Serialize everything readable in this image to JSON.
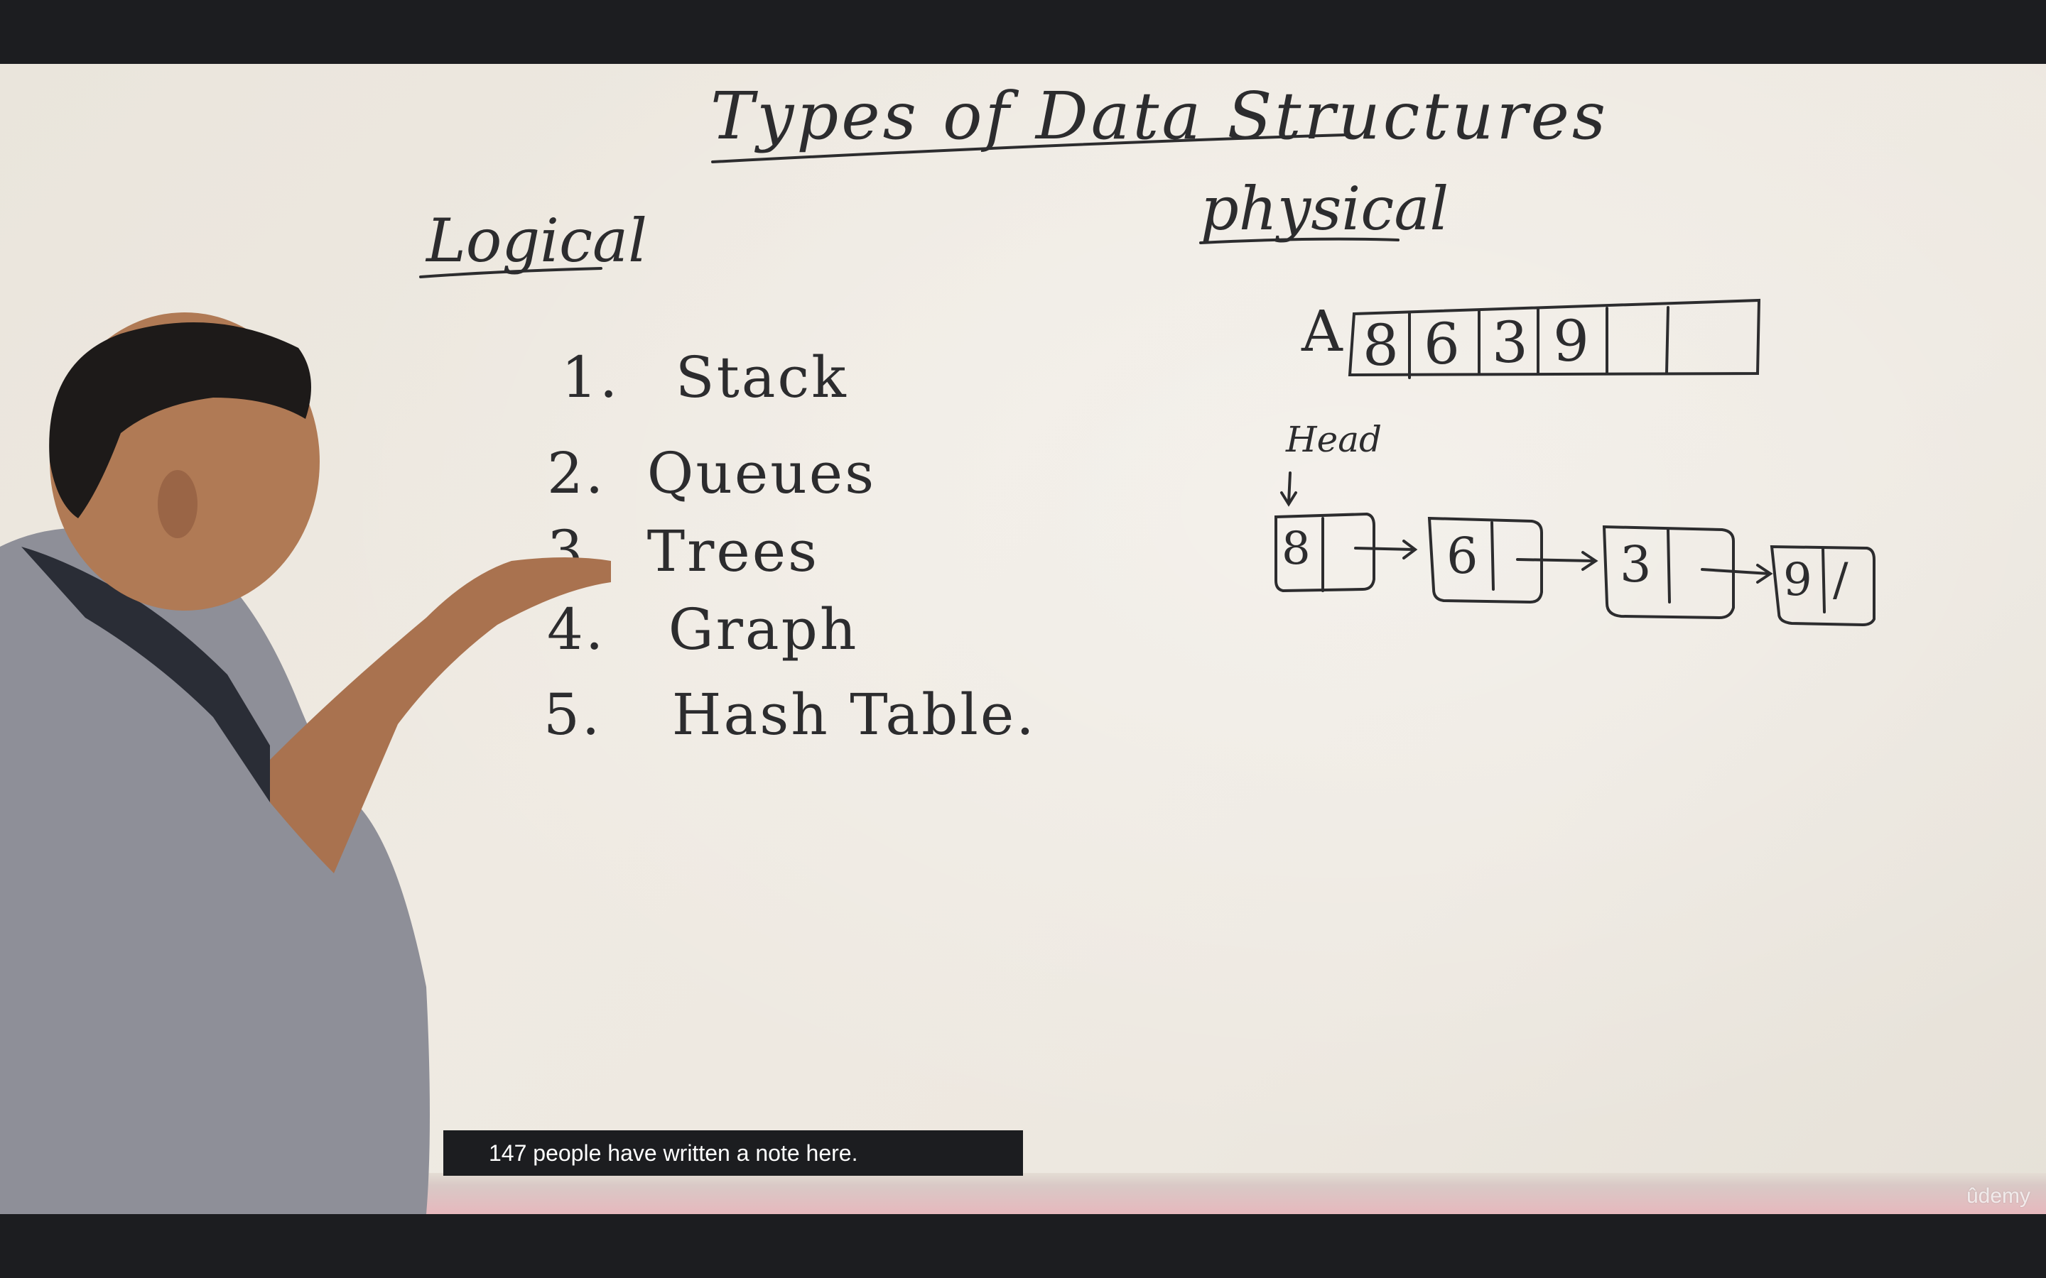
{
  "video": {
    "title": "Types of Data Structures",
    "logical_heading": "Logical",
    "physical_heading": "physical",
    "logical_items": [
      {
        "number": "1.",
        "label": "Stack"
      },
      {
        "number": "2.",
        "label": "Queues"
      },
      {
        "number": "3.",
        "label": "Trees"
      },
      {
        "number": "4.",
        "label": "Graph"
      },
      {
        "number": "5.",
        "label": "Hash Table."
      }
    ],
    "array_label": "A",
    "array_cells": [
      "8",
      "6",
      "3",
      "9",
      "",
      ""
    ],
    "linked_list_head_label": "Head",
    "linked_list_nodes": [
      "8",
      "6",
      "3",
      "9"
    ],
    "linked_list_terminator": "/"
  },
  "notes_banner": {
    "text": "147 people have written a note here."
  },
  "watermark": {
    "text": "ûdemy"
  },
  "colors": {
    "ink": "#2c2c2e",
    "board": "#ede8e0",
    "chrome": "#1c1d20",
    "banner_text": "#ffffff"
  }
}
